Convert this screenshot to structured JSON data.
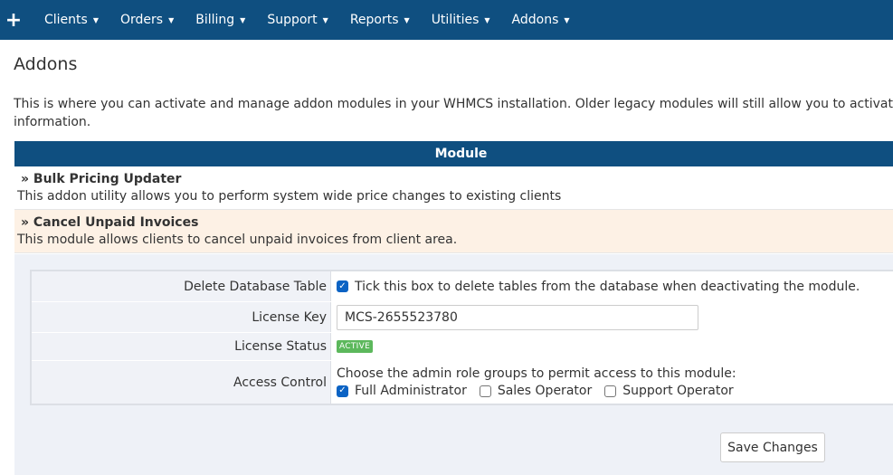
{
  "nav": {
    "items": [
      "Clients",
      "Orders",
      "Billing",
      "Support",
      "Reports",
      "Utilities",
      "Addons"
    ]
  },
  "page": {
    "title": "Addons",
    "intro_line1": "This is where you can activate and manage addon modules in your WHMCS installation. Older legacy modules will still allow you to activate/deactivate",
    "intro_line2": "information."
  },
  "modules": {
    "header": "Module",
    "rows": [
      {
        "name": "» Bulk Pricing Updater",
        "desc": "This addon utility allows you to perform system wide price changes to existing clients"
      },
      {
        "name": "» Cancel Unpaid Invoices",
        "desc": "This module allows clients to cancel unpaid invoices from client area."
      }
    ]
  },
  "config": {
    "delete_label": "Delete Database Table",
    "delete_text": "Tick this box to delete tables from the database when deactivating the module.",
    "delete_checked": true,
    "license_label": "License Key",
    "license_value": "MCS-2655523780",
    "status_label": "License Status",
    "status_badge": "ACTIVE",
    "access_label": "Access Control",
    "access_text": "Choose the admin role groups to permit access to this module:",
    "roles": [
      {
        "label": "Full Administrator",
        "checked": true
      },
      {
        "label": "Sales Operator",
        "checked": false
      },
      {
        "label": "Support Operator",
        "checked": false
      }
    ],
    "save_label": "Save Changes"
  },
  "colors": {
    "nav_bg": "#0f4f80",
    "highlight_row": "#fdf1e5",
    "config_bg": "#eef1f7",
    "badge": "#5cb85c",
    "checkbox": "#0b63c4"
  }
}
